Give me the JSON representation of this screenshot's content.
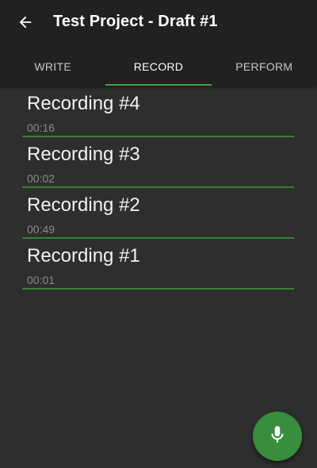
{
  "header": {
    "back_icon": "arrow-left-icon",
    "title": "Test Project - Draft #1"
  },
  "tabs": [
    {
      "label": "WRITE",
      "active": false
    },
    {
      "label": "RECORD",
      "active": true
    },
    {
      "label": "PERFORM",
      "active": false
    }
  ],
  "recordings": [
    {
      "title": "Recording #4",
      "duration": "00:16"
    },
    {
      "title": "Recording #3",
      "duration": "00:02"
    },
    {
      "title": "Recording #2",
      "duration": "00:49"
    },
    {
      "title": "Recording #1",
      "duration": "00:01"
    }
  ],
  "fab": {
    "icon": "microphone-icon"
  },
  "colors": {
    "accent": "#43a047",
    "fab": "#388e3c",
    "toolbar": "#212121",
    "background": "#2e2e2e"
  }
}
